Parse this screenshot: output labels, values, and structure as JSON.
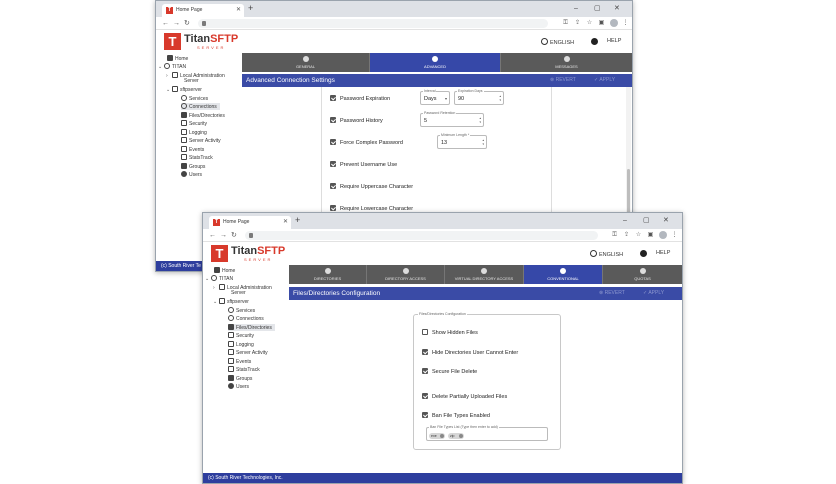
{
  "window1": {
    "tab_title": "Home Page",
    "lang": "ENGLISH",
    "help": "HELP",
    "footer": "(c) South River Te",
    "sidebar": [
      "Home",
      "TITAN",
      "Local Administration",
      "Server",
      "sftpserver",
      "Services",
      "Connections",
      "Files/Directories",
      "Security",
      "Logging",
      "Server Activity",
      "Events",
      "StatsTrack",
      "Groups",
      "Users"
    ],
    "tabs": [
      "GENERAL",
      "ADVANCED",
      "MESSAGES"
    ],
    "section_title": "Advanced Connection Settings",
    "revert": "REVERT",
    "apply": "APPLY",
    "rows": [
      {
        "label": "Password Expiration",
        "checked": true
      },
      {
        "label": "Password History",
        "checked": true
      },
      {
        "label": "Force Complex Password",
        "checked": true
      },
      {
        "label": "Prevent Username Use",
        "checked": true
      },
      {
        "label": "Require Uppercase Character",
        "checked": true
      },
      {
        "label": "Require Lowercase Character",
        "checked": true
      }
    ],
    "fields": {
      "interval_label": "Interval",
      "interval_value": "Days",
      "expiration_label": "Expiration Days",
      "expiration_value": "90",
      "retention_label": "Password Retention",
      "retention_value": "5",
      "minlen_label": "Minimum Length *",
      "minlen_value": "13"
    }
  },
  "window2": {
    "tab_title": "Home Page",
    "lang": "ENGLISH",
    "help": "HELP",
    "footer": "(c) South River Technologies, Inc.",
    "sidebar": [
      "Home",
      "TITAN",
      "Local Administration",
      "Server",
      "sftpserver",
      "Services",
      "Connections",
      "Files/Directories",
      "Security",
      "Logging",
      "Server Activity",
      "Events",
      "StatsTrack",
      "Groups",
      "Users"
    ],
    "tabs": [
      "DIRECTORIES",
      "DIRECTORY ACCESS",
      "VIRTUAL DIRECTORY ACCESS",
      "CONVENTIONAL",
      "QUOTAS"
    ],
    "section_title": "Files/Directories Configuration",
    "revert": "REVERT",
    "apply": "APPLY",
    "group_label": "Files/Directories Configuration",
    "rows": [
      {
        "label": "Show Hidden Files",
        "checked": false
      },
      {
        "label": "Hide Directories User Cannot Enter",
        "checked": true
      },
      {
        "label": "Secure File Delete",
        "checked": true
      },
      {
        "label": "Delete Partially Uploaded Files",
        "checked": true
      },
      {
        "label": "Ban File Types Enabled",
        "checked": true
      }
    ],
    "ban_list_label": "Ban File Types List (Type then enter to add)",
    "chips": [
      "exe",
      "zip"
    ]
  },
  "logo": {
    "titan": "Titan",
    "sftp": "SFTP",
    "sub": "SERVER"
  },
  "colors": {
    "brand_red": "#d8392b",
    "accent_blue": "#3a4ba6",
    "tab_gray": "#5a5a5a"
  }
}
